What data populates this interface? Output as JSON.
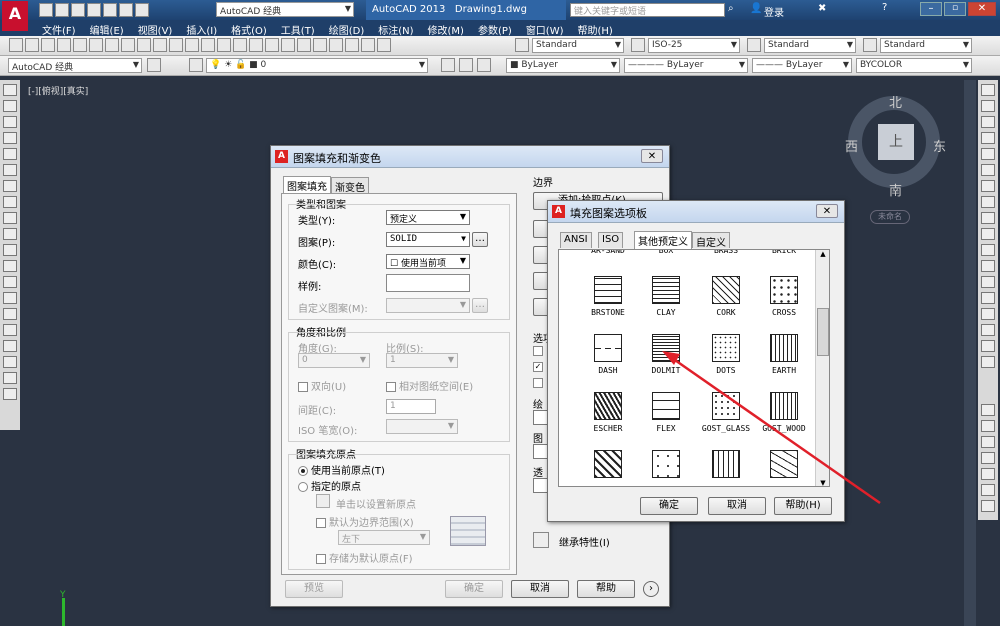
{
  "titlebar": {
    "workspace": "AutoCAD 经典",
    "app": "AutoCAD 2013",
    "file": "Drawing1.dwg",
    "search_placeholder": "键入关键字或短语",
    "login": "登录"
  },
  "menu": [
    "文件(F)",
    "编辑(E)",
    "视图(V)",
    "插入(I)",
    "格式(O)",
    "工具(T)",
    "绘图(D)",
    "标注(N)",
    "修改(M)",
    "参数(P)",
    "窗口(W)",
    "帮助(H)"
  ],
  "toolbar1": {
    "text_style": "Standard",
    "dim_style": "ISO-25",
    "table_style": "Standard",
    "mleader_style": "Standard"
  },
  "toolbar2": {
    "workspace": "AutoCAD 经典",
    "layer": "0",
    "color": "ByLayer",
    "linetype": "ByLayer",
    "lineweight": "ByLayer",
    "plotstyle": "BYCOLOR"
  },
  "viewport_label": "[-][俯视][真实]",
  "viewcube": {
    "north": "北",
    "south": "南",
    "east": "东",
    "west": "西",
    "face": "上",
    "wcs": "未命名"
  },
  "hatch_dialog": {
    "title": "图案填充和渐变色",
    "tab_hatch": "图案填充",
    "tab_gradient": "渐变色",
    "type_group": "类型和图案",
    "type_label": "类型(Y):",
    "type_value": "预定义",
    "pattern_label": "图案(P):",
    "pattern_value": "SOLID",
    "color_label": "颜色(C):",
    "color_value": "使用当前项",
    "swatch_label": "样例:",
    "custom_label": "自定义图案(M):",
    "angle_group": "角度和比例",
    "angle_label": "角度(G):",
    "angle_value": "0",
    "scale_label": "比例(S):",
    "scale_value": "1",
    "double_label": "双向(U)",
    "relative_label": "相对图纸空间(E)",
    "spacing_label": "间距(C):",
    "spacing_value": "1",
    "iso_label": "ISO 笔宽(O):",
    "origin_group": "图案填充原点",
    "use_current_origin": "使用当前原点(T)",
    "specified_origin": "指定的原点",
    "click_set_origin": "单击以设置新原点",
    "default_extent": "默认为边界范围(X)",
    "extent_value": "左下",
    "store_default": "存储为默认原点(F)",
    "boundary_label": "边界",
    "add_pick": "添加:拾取点(K)",
    "options_label": "选项",
    "draw_order_label": "绘",
    "layer_label": "图",
    "transparency_label": "透",
    "inherit_label": "继承特性(I)",
    "preview": "预览",
    "ok": "确定",
    "cancel": "取消",
    "help": "帮助"
  },
  "palette": {
    "title": "填充图案选项板",
    "tabs": [
      "ANSI",
      "ISO",
      "其他预定义",
      "自定义"
    ],
    "row_top": [
      "AR-SAND",
      "BOX",
      "BRASS",
      "BRICK"
    ],
    "patterns": [
      [
        "BRSTONE",
        "CLAY",
        "CORK",
        "CROSS"
      ],
      [
        "DASH",
        "DOLMIT",
        "DOTS",
        "EARTH"
      ],
      [
        "ESCHER",
        "FLEX",
        "GOST_GLASS",
        "GOST_WOOD"
      ],
      [
        "",
        "",
        "",
        ""
      ]
    ],
    "ok": "确定",
    "cancel": "取消",
    "help": "帮助(H)"
  },
  "accent": "#e0202a"
}
